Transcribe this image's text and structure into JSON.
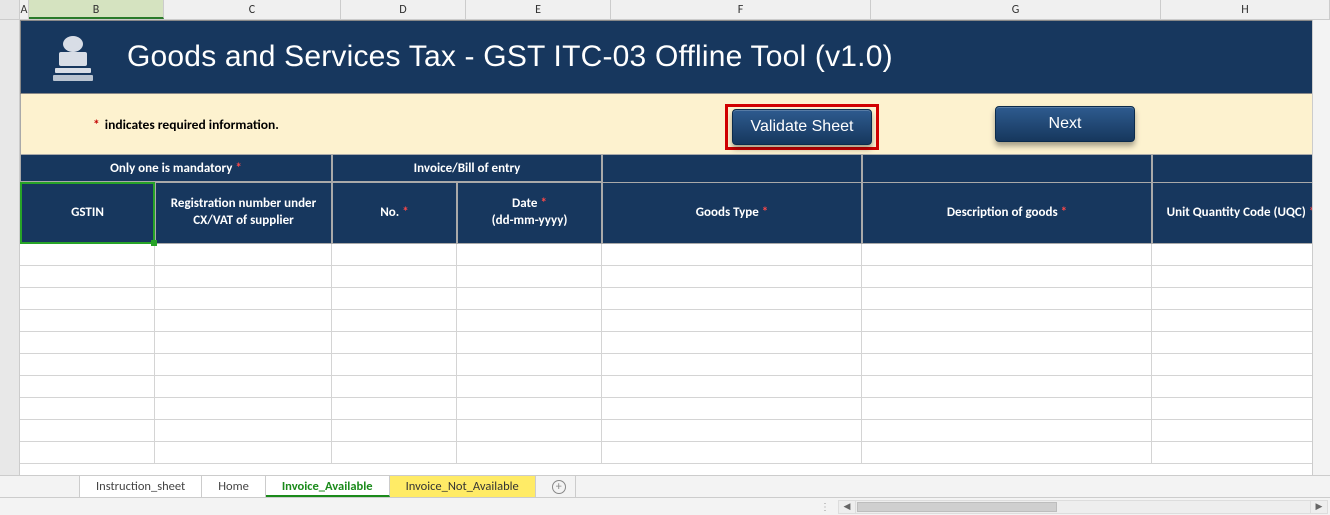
{
  "columns": [
    "A",
    "B",
    "C",
    "D",
    "E",
    "F",
    "G",
    "H"
  ],
  "active_column": "B",
  "banner": {
    "title": "Goods and Services Tax - GST ITC-03 Offline Tool (v1.0)"
  },
  "info": {
    "required_note": "indicates required information."
  },
  "buttons": {
    "validate": "Validate Sheet",
    "next": "Next"
  },
  "group_headers": {
    "mandatory": "Only one is mandatory",
    "invoice": "Invoice/Bill of entry"
  },
  "headers": {
    "gstin": "GSTIN",
    "reg_no": "Registration number under CX/VAT of supplier",
    "no": "No.",
    "date": "Date",
    "date_fmt": "(dd-mm-yyyy)",
    "goods_type": "Goods Type",
    "description": "Description of goods",
    "uqc": "Unit Quantity Code (UQC)"
  },
  "tabs": {
    "instruction": "Instruction_sheet",
    "home": "Home",
    "invoice_available": "Invoice_Available",
    "invoice_not_available": "Invoice_Not_Available"
  }
}
